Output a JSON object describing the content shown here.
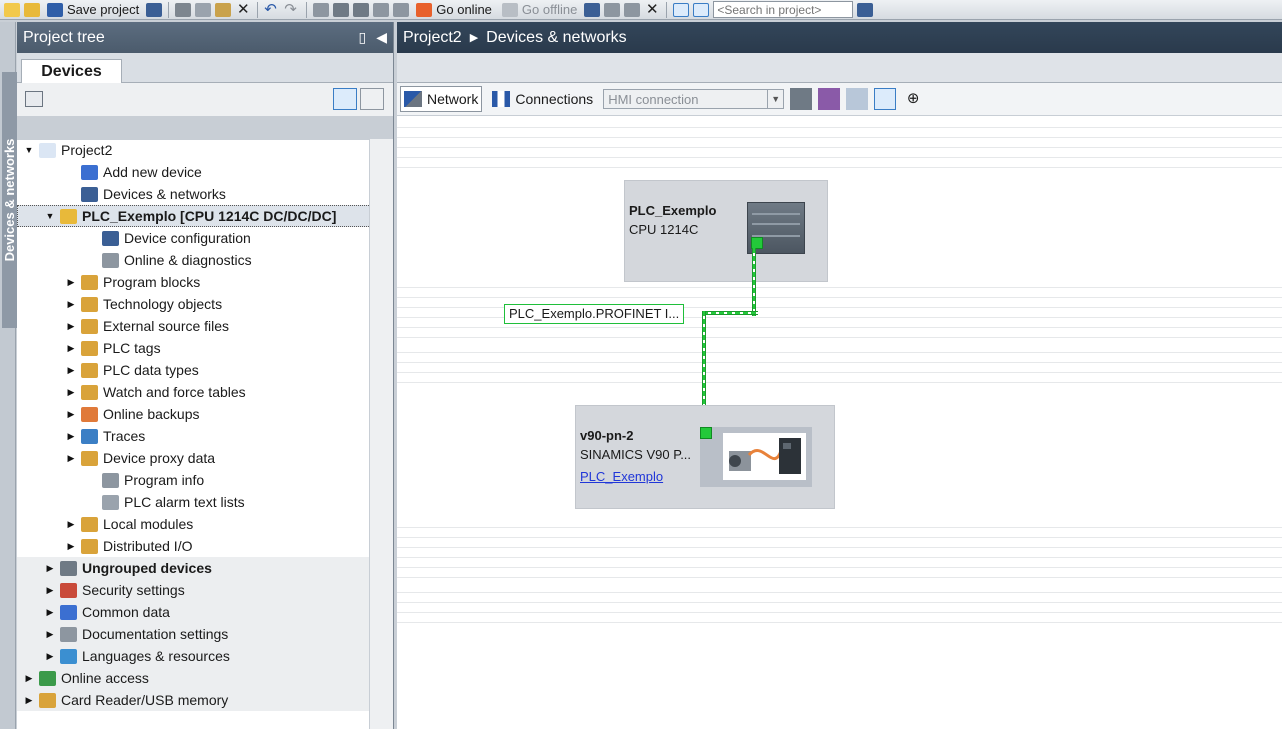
{
  "toolbar": {
    "save_label": "Save project",
    "go_online_label": "Go online",
    "go_offline_label": "Go offline",
    "search_placeholder": "<Search in project>"
  },
  "side_tab": {
    "label": "Devices & networks"
  },
  "project_tree": {
    "title": "Project tree",
    "tab_label": "Devices",
    "items": [
      {
        "label": "Project2",
        "expander": "▼"
      },
      {
        "label": "Add new device",
        "expander": ""
      },
      {
        "label": "Devices & networks",
        "expander": ""
      },
      {
        "label": "PLC_Exemplo [CPU 1214C DC/DC/DC]",
        "expander": "▼"
      },
      {
        "label": "Device configuration",
        "expander": ""
      },
      {
        "label": "Online & diagnostics",
        "expander": ""
      },
      {
        "label": "Program blocks",
        "expander": "▶"
      },
      {
        "label": "Technology objects",
        "expander": "▶"
      },
      {
        "label": "External source files",
        "expander": "▶"
      },
      {
        "label": "PLC tags",
        "expander": "▶"
      },
      {
        "label": "PLC data types",
        "expander": "▶"
      },
      {
        "label": "Watch and force tables",
        "expander": "▶"
      },
      {
        "label": "Online backups",
        "expander": "▶"
      },
      {
        "label": "Traces",
        "expander": "▶"
      },
      {
        "label": "Device proxy data",
        "expander": "▶"
      },
      {
        "label": "Program info",
        "expander": ""
      },
      {
        "label": "PLC alarm text lists",
        "expander": ""
      },
      {
        "label": "Local modules",
        "expander": "▶"
      },
      {
        "label": "Distributed I/O",
        "expander": "▶"
      },
      {
        "label": "Ungrouped devices",
        "expander": "▶"
      },
      {
        "label": "Security settings",
        "expander": "▶"
      },
      {
        "label": "Common data",
        "expander": "▶"
      },
      {
        "label": "Documentation settings",
        "expander": "▶"
      },
      {
        "label": "Languages & resources",
        "expander": "▶"
      },
      {
        "label": "Online access",
        "expander": "▶"
      },
      {
        "label": "Card Reader/USB memory",
        "expander": "▶"
      }
    ]
  },
  "editor": {
    "breadcrumb": [
      "Project2",
      "Devices & networks"
    ],
    "network_label": "Network",
    "connections_label": "Connections",
    "connection_type": "HMI connection"
  },
  "network_view": {
    "plc": {
      "name": "PLC_Exemplo",
      "type": "CPU 1214C"
    },
    "subnet": {
      "label": "PLC_Exemplo.PROFINET I..."
    },
    "drive": {
      "name": "v90-pn-2",
      "type": "SINAMICS V90 P...",
      "controller_link": "PLC_Exemplo"
    }
  },
  "colors": {
    "header_dark": "#2a3a4c",
    "profinet_green": "#23c93a",
    "device_fill": "#d4d7dc",
    "link_blue": "#2036d8"
  }
}
